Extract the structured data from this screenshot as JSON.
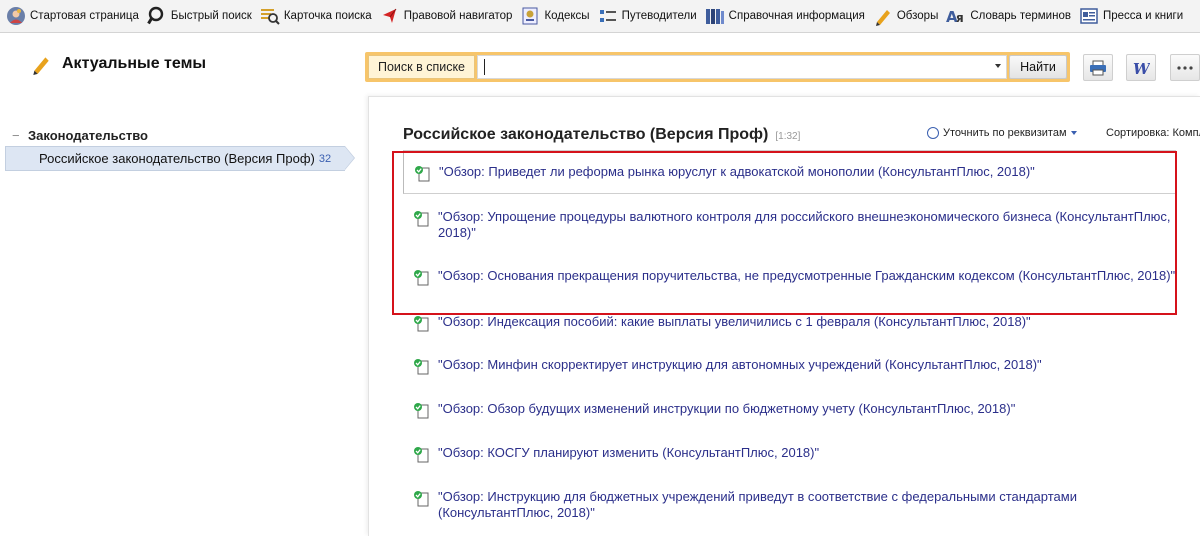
{
  "toolbar": {
    "items": [
      {
        "label": "Стартовая страница",
        "icon": "start-page-icon"
      },
      {
        "label": "Быстрый поиск",
        "icon": "search-icon"
      },
      {
        "label": "Карточка поиска",
        "icon": "search-card-icon"
      },
      {
        "label": "Правовой навигатор",
        "icon": "legal-navigator-icon"
      },
      {
        "label": "Кодексы",
        "icon": "codes-icon"
      },
      {
        "label": "Путеводители",
        "icon": "guides-icon"
      },
      {
        "label": "Справочная информация",
        "icon": "reference-books-icon"
      },
      {
        "label": "Обзоры",
        "icon": "reviews-pen-icon"
      },
      {
        "label": "Словарь терминов",
        "icon": "dictionary-icon"
      },
      {
        "label": "Пресса и книги",
        "icon": "press-icon"
      }
    ]
  },
  "left": {
    "title": "Актуальные темы",
    "tree_header": "Законодательство",
    "tree_item": {
      "label": "Российское законодательство (Версия Проф)",
      "count": "32"
    }
  },
  "search": {
    "tab_label": "Поиск в списке",
    "input_value": "",
    "find_label": "Найти"
  },
  "main": {
    "title": "Российское законодательство (Версия Проф)",
    "count": "[1:32]",
    "refine_label": "Уточнить по реквизитам",
    "sort_label": "Сортировка: Компл"
  },
  "documents": [
    "\"Обзор: Приведет ли реформа рынка юруслуг к адвокатской монополии (КонсультантПлюс, 2018)\"",
    "\"Обзор: Упрощение процедуры валютного контроля для российского внешнеэкономического бизнеса (КонсультантПлюс, 2018)\"",
    "\"Обзор: Основания прекращения поручительства, не предусмотренные Гражданским кодексом (КонсультантПлюс, 2018)\"",
    "\"Обзор: Индексация пособий: какие выплаты увеличились с 1 февраля (КонсультантПлюс, 2018)\"",
    "\"Обзор: Минфин скорректирует инструкцию для автономных учреждений (КонсультантПлюс, 2018)\"",
    "\"Обзор: Обзор будущих изменений инструкции по бюджетному учету (КонсультантПлюс, 2018)\"",
    "\"Обзор: КОСГУ планируют изменить (КонсультантПлюс, 2018)\"",
    "\"Обзор: Инструкцию для бюджетных учреждений приведут в соответствие с федеральными стандартами (КонсультантПлюс, 2018)\""
  ],
  "colors": {
    "accent": "#f7c56a",
    "link": "#2b2f8a",
    "highlight": "#d5121b",
    "selection": "#dde6f3"
  }
}
